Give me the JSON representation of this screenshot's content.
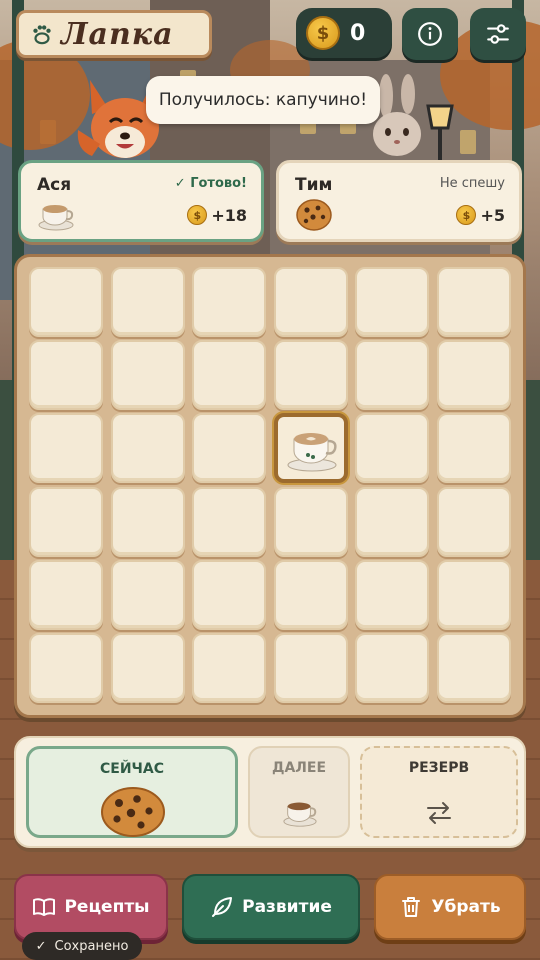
{
  "header": {
    "title": "Лапка",
    "coins": "0"
  },
  "speech_bubble": "Получилось: капучино!",
  "orders": [
    {
      "name": "Ася",
      "status": "Готово!",
      "item": "cappuccino-icon",
      "reward": "+18"
    },
    {
      "name": "Тим",
      "status": "Не спешу",
      "item": "cookie-icon",
      "reward": "+5"
    }
  ],
  "board": {
    "rows": 6,
    "cols": 6,
    "items": [
      {
        "row": 3,
        "col": 4,
        "item": "cappuccino-icon"
      }
    ]
  },
  "queue": {
    "now_label": "СЕЙЧАС",
    "now_item": "cookie-icon",
    "next_label": "ДАЛЕЕ",
    "next_item": "cappuccino-icon",
    "reserve_label": "РЕЗЕРВ",
    "reserve_icon": "swap-icon"
  },
  "buttons": {
    "recipes": "Рецепты",
    "development": "Развитие",
    "remove": "Убрать"
  },
  "toast": "Сохранено",
  "colors": {
    "accent_green": "#2f6e54",
    "recipes_button": "#b24c63",
    "remove_button": "#c97f3d",
    "coin_gold": "#f7c84a"
  }
}
